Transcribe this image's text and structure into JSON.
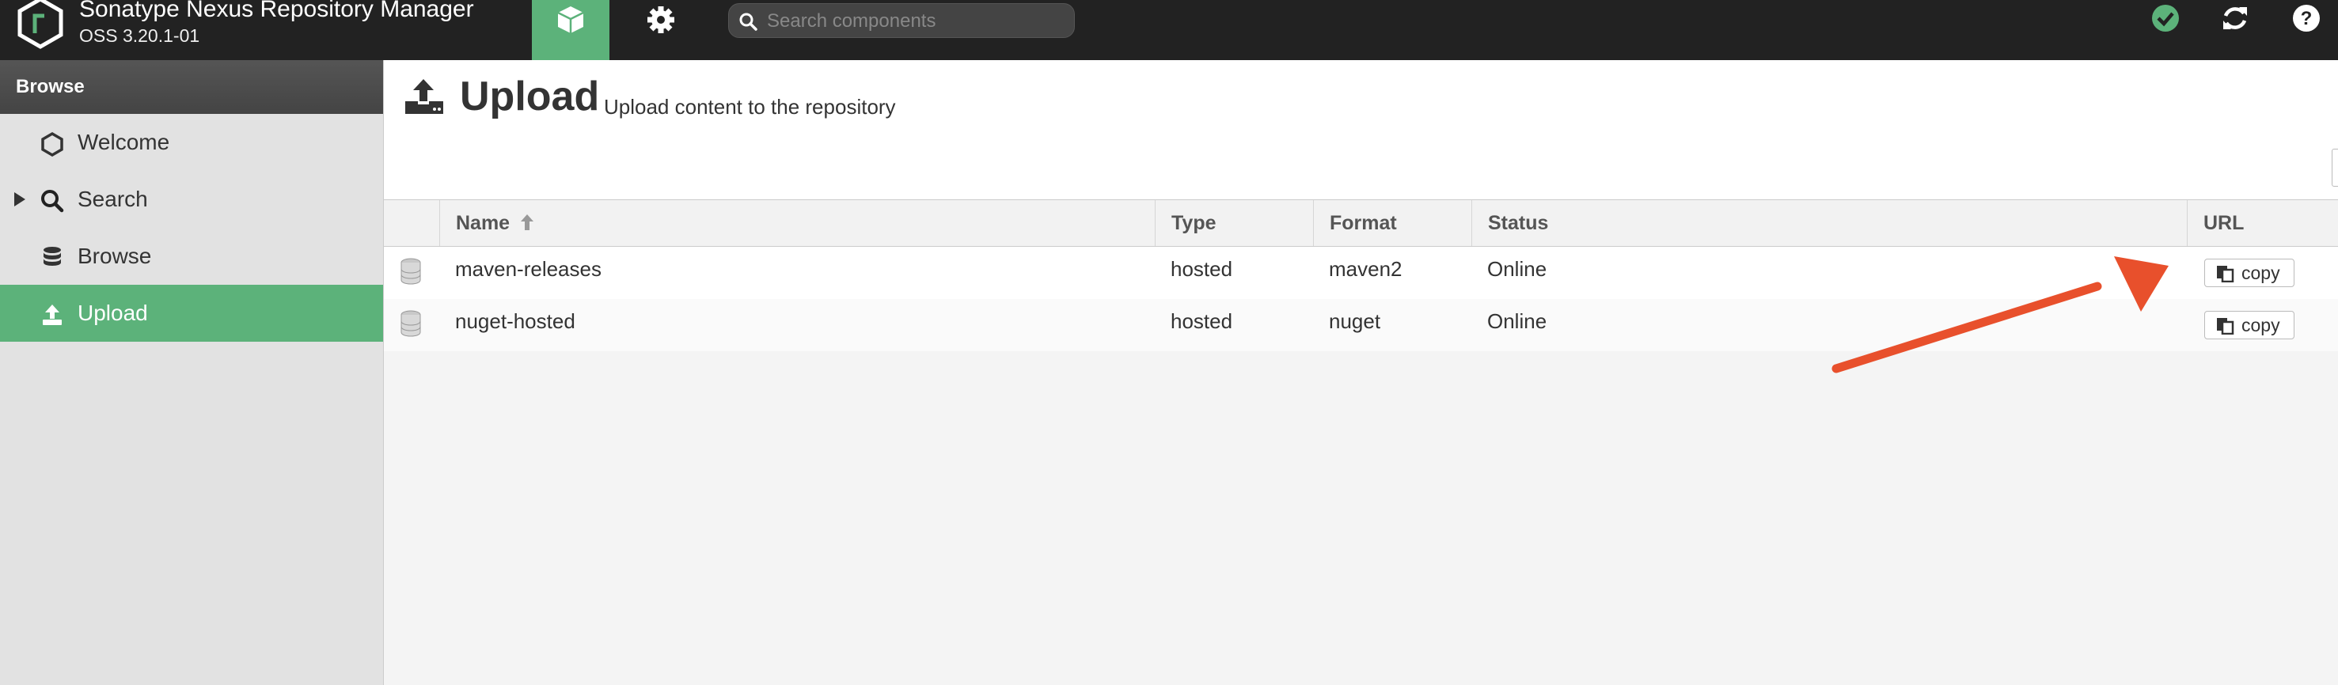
{
  "app": {
    "name": "Sonatype Nexus Repository Manager",
    "version": "OSS 3.20.1-01"
  },
  "search": {
    "placeholder": "Search components"
  },
  "sidebar": {
    "header": "Browse",
    "items": [
      {
        "label": "Welcome",
        "icon": "hexagon-icon"
      },
      {
        "label": "Search",
        "icon": "search-icon"
      },
      {
        "label": "Browse",
        "icon": "database-icon"
      },
      {
        "label": "Upload",
        "icon": "upload-icon",
        "active": true
      }
    ]
  },
  "page": {
    "title": "Upload",
    "subtitle": "Upload content to the repository"
  },
  "table": {
    "columns": [
      "Name",
      "Type",
      "Format",
      "Status",
      "URL"
    ],
    "rows": [
      {
        "name": "maven-releases",
        "type": "hosted",
        "format": "maven2",
        "status": "Online",
        "url_button": "copy"
      },
      {
        "name": "nuget-hosted",
        "type": "hosted",
        "format": "nuget",
        "status": "Online",
        "url_button": "copy"
      }
    ]
  },
  "colors": {
    "topbar": "#222222",
    "accent": "#5cb27a",
    "annotation_arrow": "#e8502c"
  }
}
